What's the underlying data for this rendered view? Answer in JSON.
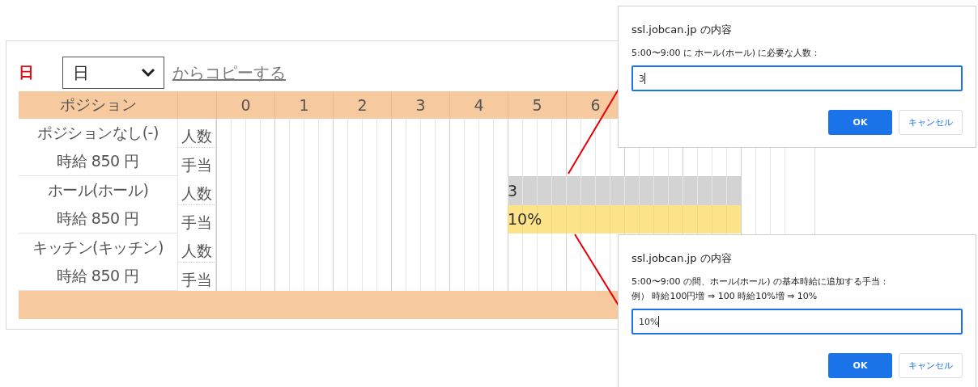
{
  "toolbar": {
    "day_label": "日",
    "select": {
      "value": "日"
    },
    "copy_link": "からコピーする"
  },
  "table": {
    "header": {
      "position": "ポジション",
      "hours": [
        "0",
        "1",
        "2",
        "3",
        "4",
        "5",
        "6"
      ]
    },
    "positions": [
      {
        "name": "ポジションなし(-)",
        "wage": "時給 850 円",
        "rows": [
          {
            "label": "人数"
          },
          {
            "label": "手当"
          }
        ]
      },
      {
        "name": "ホール(ホール)",
        "wage": "時給 850 円",
        "rows": [
          {
            "label": "人数",
            "bar": {
              "kind": "headcount",
              "text": "3",
              "slots": [
                {
                  "filled": false
                },
                {
                  "filled": false
                },
                {
                  "filled": false
                },
                {
                  "filled": false
                },
                {
                  "filled": false
                },
                {
                  "filled": true
                },
                {
                  "filled": true
                },
                {
                  "filled": true
                },
                {
                  "filled": true
                },
                {
                  "filled": false
                }
              ]
            }
          },
          {
            "label": "手当",
            "bar": {
              "kind": "allowance",
              "text": "10%",
              "slots": [
                {
                  "filled": false
                },
                {
                  "filled": false
                },
                {
                  "filled": false
                },
                {
                  "filled": false
                },
                {
                  "filled": false
                },
                {
                  "filled": true
                },
                {
                  "filled": true
                },
                {
                  "filled": true
                },
                {
                  "filled": true
                },
                {
                  "filled": false
                }
              ]
            }
          }
        ]
      },
      {
        "name": "キッチン(キッチン)",
        "wage": "時給 850 円",
        "rows": [
          {
            "label": "人数"
          },
          {
            "label": "手当"
          }
        ]
      }
    ]
  },
  "dialogs": [
    {
      "title": "ssl.jobcan.jp の内容",
      "message": [
        "5:00〜9:00 に ホール(ホール) に必要な人数："
      ],
      "value": "3",
      "ok": "OK",
      "cancel": "キャンセル"
    },
    {
      "title": "ssl.jobcan.jp の内容",
      "message": [
        "5:00〜9:00 の間、ホール(ホール) の基本時給に追加する手当：",
        "例）  時給100円増 ⇒ 100  時給10%増 ⇒ 10%"
      ],
      "value": "10%",
      "ok": "OK",
      "cancel": "キャンセル"
    }
  ]
}
